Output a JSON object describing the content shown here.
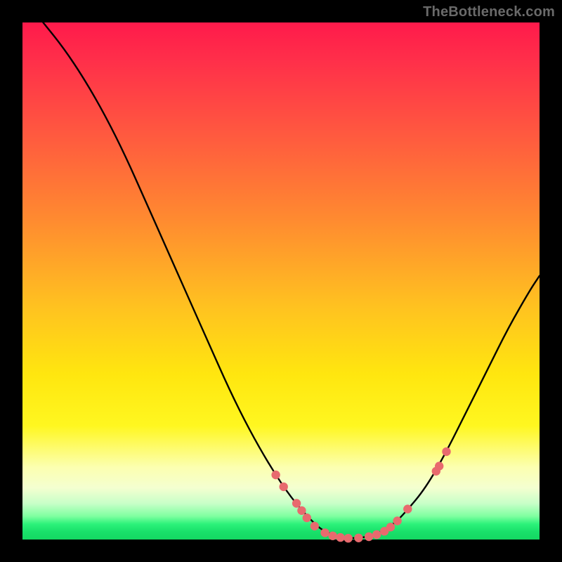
{
  "watermark": "TheBottleneck.com",
  "colors": {
    "curve_stroke": "#000000",
    "dot_fill": "#e86a6e",
    "dot_stroke": "#c24a52"
  },
  "chart_data": {
    "type": "line",
    "title": "",
    "xlabel": "",
    "ylabel": "",
    "xlim": [
      0,
      100
    ],
    "ylim": [
      0,
      100
    ],
    "curve_xy": [
      [
        4,
        100
      ],
      [
        8,
        95
      ],
      [
        12,
        89
      ],
      [
        16,
        82
      ],
      [
        20,
        74
      ],
      [
        24,
        65
      ],
      [
        28,
        56
      ],
      [
        32,
        47
      ],
      [
        36,
        38
      ],
      [
        40,
        29
      ],
      [
        44,
        21
      ],
      [
        48,
        14
      ],
      [
        52,
        8
      ],
      [
        56,
        3.5
      ],
      [
        58,
        1.8
      ],
      [
        60,
        0.9
      ],
      [
        62,
        0.4
      ],
      [
        64,
        0.25
      ],
      [
        66,
        0.4
      ],
      [
        68,
        0.9
      ],
      [
        70,
        1.8
      ],
      [
        72,
        3.2
      ],
      [
        74,
        5.2
      ],
      [
        78,
        10
      ],
      [
        82,
        17
      ],
      [
        86,
        25
      ],
      [
        90,
        33
      ],
      [
        94,
        41
      ],
      [
        98,
        48
      ],
      [
        100,
        51
      ]
    ],
    "dots_xy": [
      [
        49,
        12.5
      ],
      [
        50.5,
        10.2
      ],
      [
        53,
        7.0
      ],
      [
        54,
        5.6
      ],
      [
        55,
        4.2
      ],
      [
        56.5,
        2.6
      ],
      [
        58.5,
        1.3
      ],
      [
        60,
        0.7
      ],
      [
        61.5,
        0.4
      ],
      [
        63,
        0.25
      ],
      [
        65,
        0.3
      ],
      [
        67,
        0.55
      ],
      [
        68.5,
        0.95
      ],
      [
        70,
        1.6
      ],
      [
        71.2,
        2.4
      ],
      [
        72.5,
        3.6
      ],
      [
        74.5,
        5.9
      ],
      [
        80,
        13.2
      ],
      [
        80.6,
        14.2
      ],
      [
        82,
        17.0
      ]
    ]
  }
}
